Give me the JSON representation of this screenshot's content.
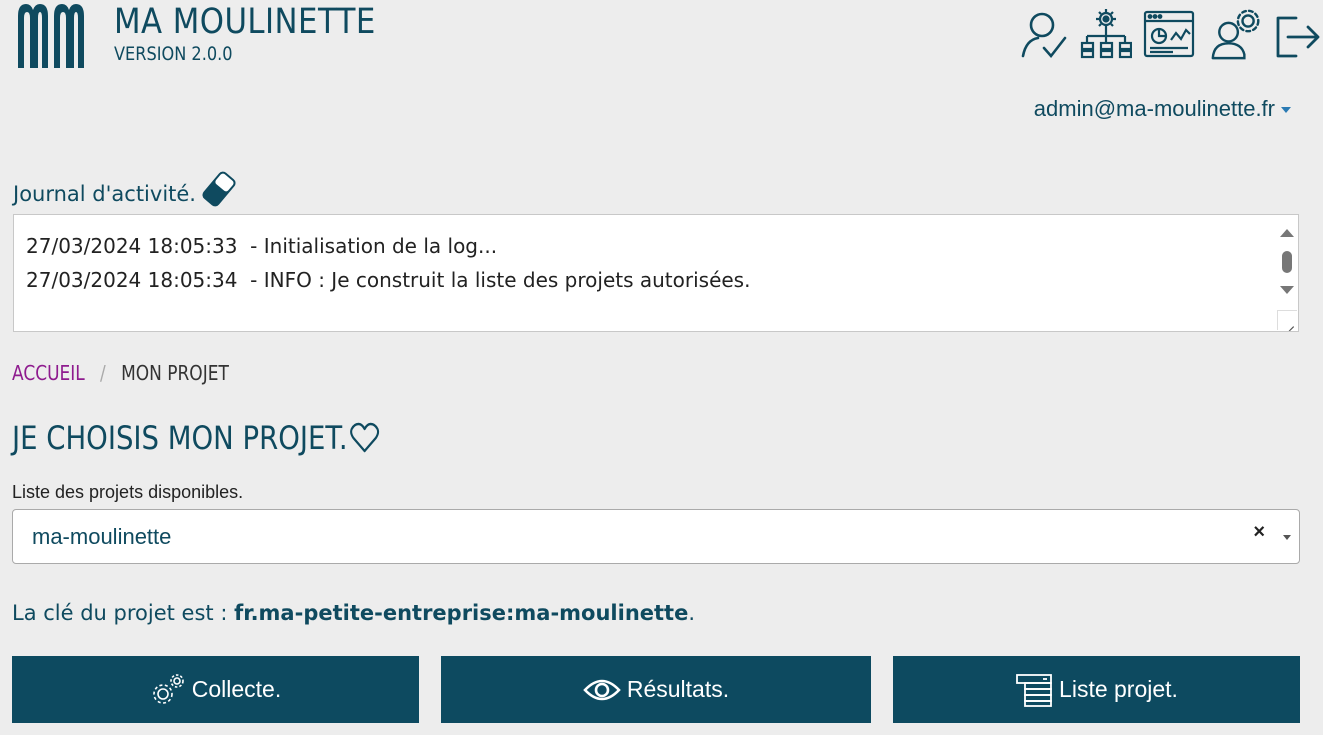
{
  "header": {
    "app_title": "MA MOULINETTE",
    "app_version": "VERSION 2.0.0",
    "icons": [
      "user-check-icon",
      "hierarchy-settings-icon",
      "dashboard-window-icon",
      "user-settings-icon",
      "logout-icon"
    ]
  },
  "user": {
    "email": "admin@ma-moulinette.fr"
  },
  "log": {
    "title": "Journal d'activité.",
    "lines": [
      "27/03/2024 18:05:33  - Initialisation de la log...",
      "27/03/2024 18:05:34  - INFO : Je construit la liste des projets autorisées."
    ]
  },
  "breadcrumb": {
    "home": "ACCUEIL",
    "separator": "/",
    "current": "MON PROJET"
  },
  "page": {
    "title": "JE CHOISIS MON PROJET."
  },
  "project_select": {
    "label": "Liste des projets disponibles.",
    "value": "ma-moulinette",
    "clear": "×"
  },
  "project_key": {
    "prefix": "La clé du projet est : ",
    "key": "fr.ma-petite-entreprise:ma-moulinette",
    "suffix": "."
  },
  "actions": {
    "collecte": "Collecte.",
    "resultats": "Résultats.",
    "liste": "Liste projet."
  },
  "colors": {
    "primary": "#0d4a60",
    "breadcrumb_link": "#8e1b8e",
    "background": "#ededed"
  }
}
